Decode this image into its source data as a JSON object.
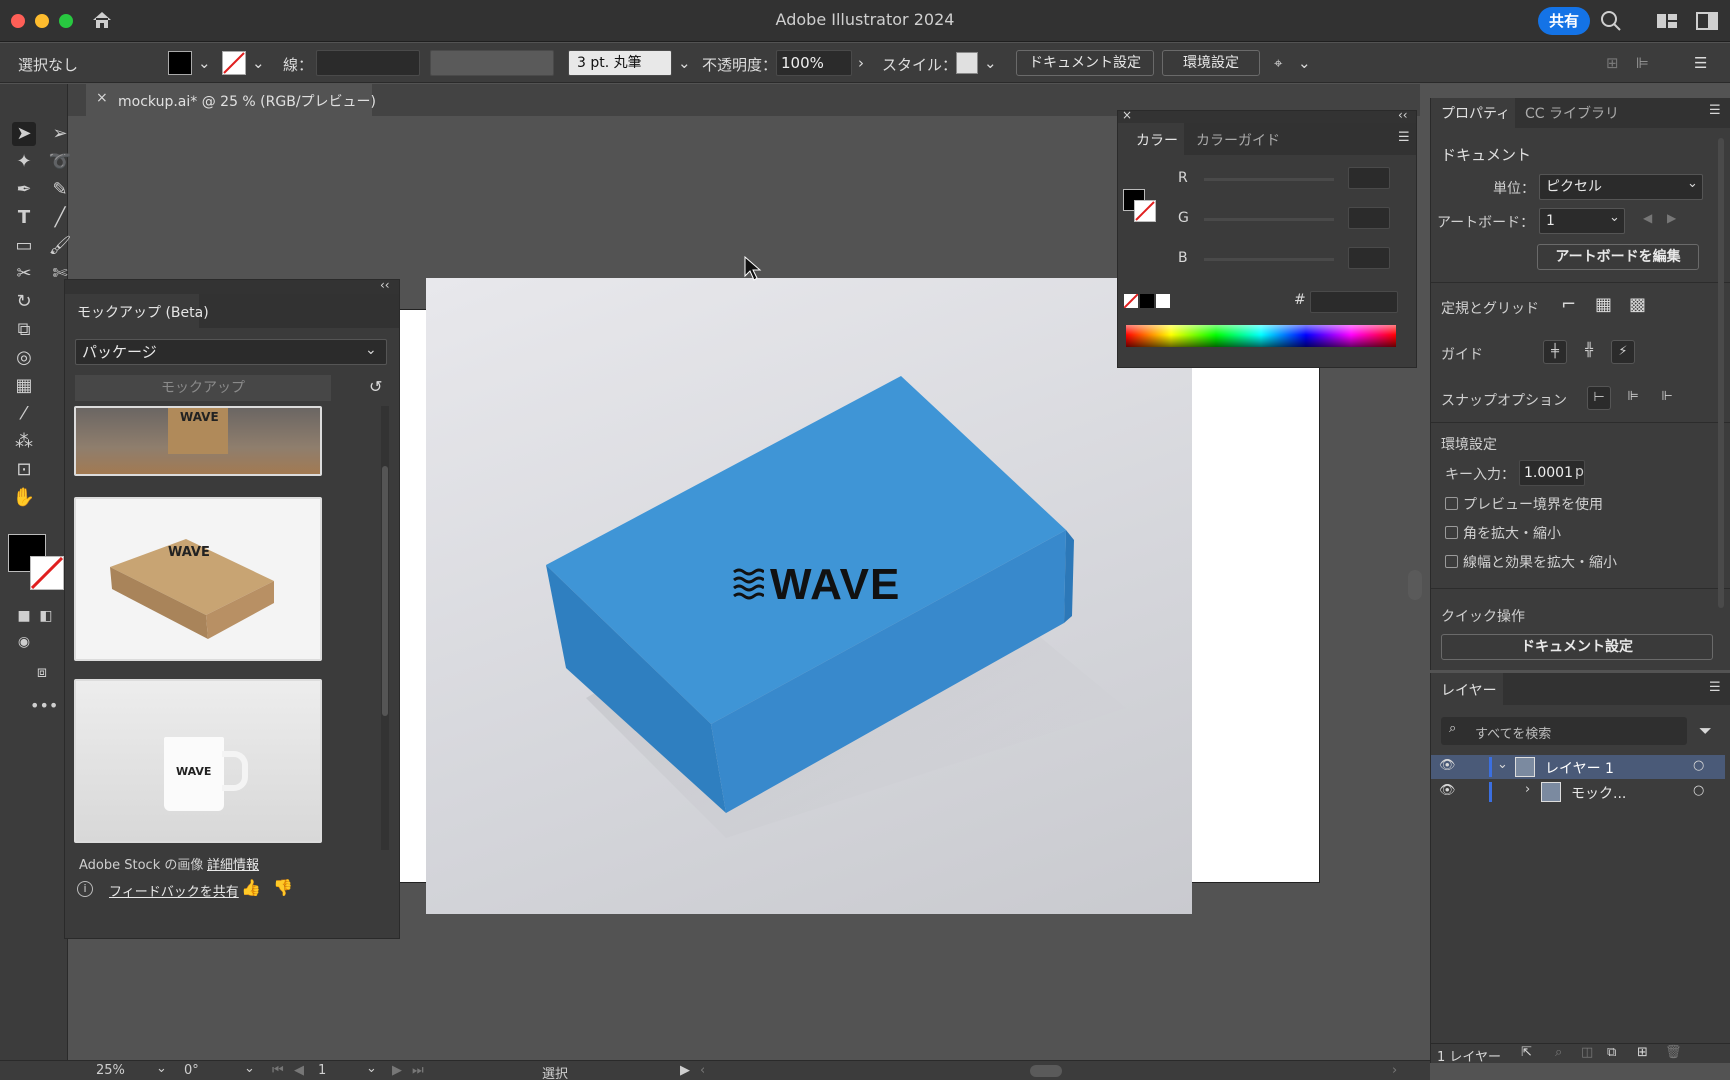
{
  "app": {
    "title": "Adobe Illustrator 2024",
    "share_label": "共有"
  },
  "control": {
    "selection": "選択なし",
    "stroke_label": "線：",
    "brush": "3 pt. 丸筆",
    "opacity_label": "不透明度：",
    "opacity_value": "100%",
    "style_label": "スタイル：",
    "doc_setup": "ドキュメント設定",
    "preferences": "環境設定"
  },
  "document_tab": {
    "title": "mockup.ai* @ 25 % (RGB/プレビュー)",
    "close": "×"
  },
  "mockup_panel": {
    "tab": "モックアップ (Beta)",
    "category": "パッケージ",
    "mockup_button": "モックアップ",
    "stock_text": "Adobe Stock の画像",
    "detail_link": "詳細情報",
    "feedback": "フィードバックを共有",
    "thumb_logo": "WAVE"
  },
  "canvas": {
    "logo_text": "WAVE"
  },
  "color_panel": {
    "tab_color": "カラー",
    "tab_guide": "カラーガイド",
    "channels": [
      "R",
      "G",
      "B"
    ],
    "hex_label": "#"
  },
  "properties": {
    "tab_props": "プロパティ",
    "tab_cc": "CC ライブラリ",
    "document_heading": "ドキュメント",
    "units_label": "単位：",
    "units_value": "ピクセル",
    "artboard_label": "アートボード：",
    "artboard_value": "1",
    "edit_artboard": "アートボードを編集",
    "rulers_grid": "定規とグリッド",
    "guides": "ガイド",
    "snap_options": "スナップオプション",
    "prefs_heading": "環境設定",
    "key_input_label": "キー入力：",
    "key_input_value": "1.0001",
    "key_input_unit": "p",
    "checks": [
      "プレビュー境界を使用",
      "角を拡大・縮小",
      "線幅と効果を拡大・縮小"
    ],
    "quick_actions": "クイック操作",
    "doc_setup_button": "ドキュメント設定"
  },
  "layers": {
    "tab": "レイヤー",
    "search_placeholder": "すべてを検索",
    "rows": [
      {
        "name": "レイヤー 1"
      },
      {
        "name": "モック..."
      }
    ],
    "footer": "1 レイヤー"
  },
  "status": {
    "zoom": "25%",
    "rotation": "0°",
    "artboard": "1",
    "tool": "選択"
  },
  "colors": {
    "accent": "#1473e6",
    "box_blue": "#3f95d6",
    "panel_bg": "#3c3c3c",
    "canvas_bg": "#535353"
  }
}
